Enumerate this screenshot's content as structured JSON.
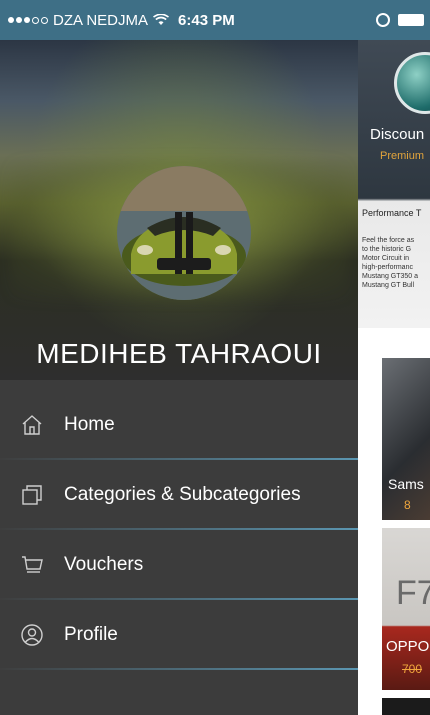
{
  "status_bar": {
    "carrier": "DZA NEDJMA",
    "time": "6:43 PM"
  },
  "drawer": {
    "user_name": "MEDIHEB TAHRAOUI",
    "menu": [
      {
        "label": "Home",
        "icon": "home-icon"
      },
      {
        "label": "Categories & Subcategories",
        "icon": "categories-icon"
      },
      {
        "label": "Vouchers",
        "icon": "cart-icon"
      },
      {
        "label": "Profile",
        "icon": "profile-icon"
      }
    ]
  },
  "content": {
    "promo": {
      "title": "Discoun",
      "subtitle": "Premium",
      "section_title": "Performance T",
      "text_lines": [
        "Feel the force as",
        "to the historic G",
        "Motor Circuit in",
        "high-performanc",
        "Mustang GT350 a",
        "Mustang GT Bull"
      ]
    },
    "products": [
      {
        "label": "Sams",
        "price": "8"
      },
      {
        "label": "OPPO",
        "price": "700",
        "banner_text": "F7"
      }
    ]
  },
  "colors": {
    "status_bar": "#3e6f86",
    "drawer": "#3c3c3c",
    "divider": "#5ea0be",
    "accent": "#f0a63d"
  }
}
